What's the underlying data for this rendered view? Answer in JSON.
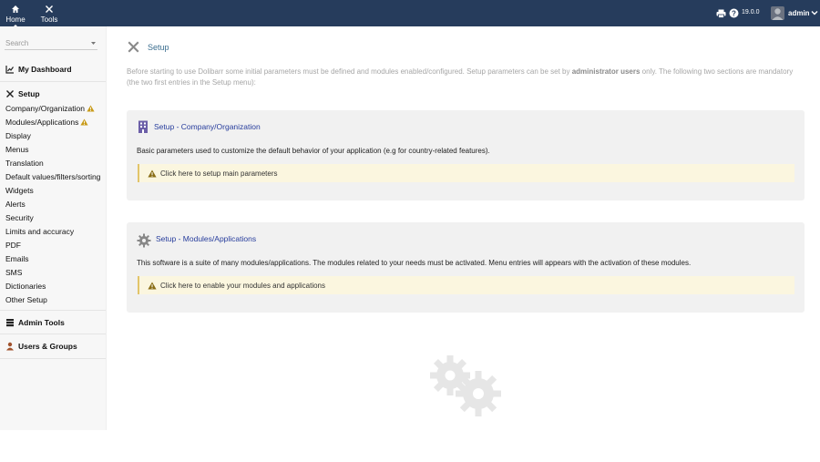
{
  "topbar": {
    "nav": [
      {
        "label": "Home",
        "icon": "home-icon",
        "active": true
      },
      {
        "label": "Tools",
        "icon": "tools-icon",
        "active": false
      }
    ],
    "version": "19.0.0",
    "username": "admin"
  },
  "sidebar": {
    "search_placeholder": "Search",
    "dashboard": "My Dashboard",
    "setup_head": "Setup",
    "setup_items": [
      {
        "label": "Company/Organization",
        "warning": true
      },
      {
        "label": "Modules/Applications",
        "warning": true
      },
      {
        "label": "Display"
      },
      {
        "label": "Menus"
      },
      {
        "label": "Translation"
      },
      {
        "label": "Default values/filters/sorting"
      },
      {
        "label": "Widgets"
      },
      {
        "label": "Alerts"
      },
      {
        "label": "Security"
      },
      {
        "label": "Limits and accuracy"
      },
      {
        "label": "PDF"
      },
      {
        "label": "Emails"
      },
      {
        "label": "SMS"
      },
      {
        "label": "Dictionaries"
      },
      {
        "label": "Other Setup"
      }
    ],
    "admin_tools": "Admin Tools",
    "users_groups": "Users & Groups"
  },
  "main": {
    "title": "Setup",
    "intro_1": "Before starting to use Dolibarr some initial parameters must be defined and modules enabled/configured. Setup parameters can be set by ",
    "intro_bold": "administrator users",
    "intro_2": " only. The following two sections are mandatory (the two first entries in the Setup menu):",
    "company_box": {
      "title_prefix": "Setup - ",
      "title_link": "Company/Organization",
      "desc": "Basic parameters used to customize the default behavior of your application (e.g for country-related features).",
      "link": "Click here to setup main parameters"
    },
    "modules_box": {
      "title_prefix": "Setup - ",
      "title_link": "Modules/Applications",
      "desc": "This software is a suite of many modules/applications. The modules related to your needs must be activated. Menu entries will appears with the activation of these modules.",
      "link": "Click here to enable your modules and applications"
    }
  },
  "colors": {
    "topbar": "#263c5c",
    "link": "#263c9c",
    "warning": "#c89b1a",
    "notice_bg": "#fbf6df"
  }
}
